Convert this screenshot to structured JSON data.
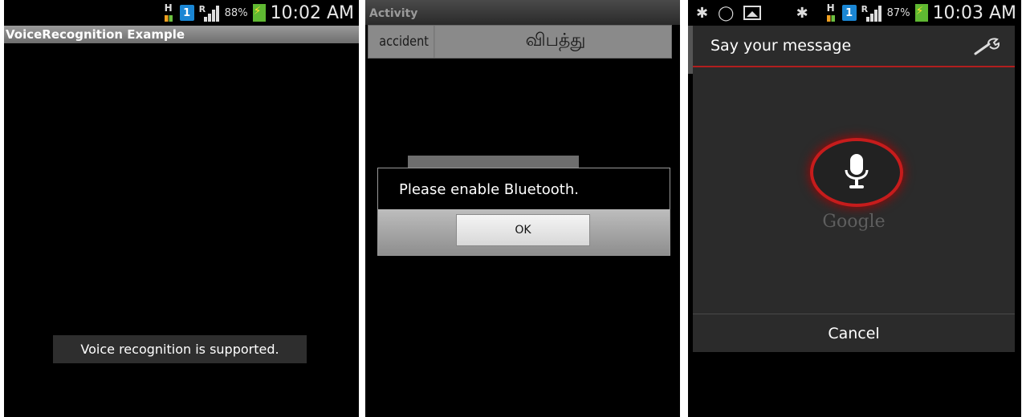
{
  "screen1": {
    "status": {
      "battery": "88%",
      "time": "10:02 AM"
    },
    "title": "VoiceRecognition Example",
    "toast": "Voice recognition is supported."
  },
  "screen2": {
    "title": "Activity",
    "row": {
      "english": "accident",
      "tamil": "விபத்து"
    },
    "dialog": {
      "message": "Please enable Bluetooth.",
      "ok": "OK"
    }
  },
  "screen3": {
    "status": {
      "battery": "87%",
      "time": "10:03 AM"
    },
    "dialog": {
      "title": "Say your message",
      "brand": "Google",
      "cancel": "Cancel"
    }
  },
  "colors": {
    "accent_red": "#c61c1c",
    "battery_green": "#5fb832",
    "sim_blue": "#1a86d4"
  },
  "icons": [
    "h-data-icon",
    "sim-icon",
    "signal-icon",
    "battery-icon",
    "bluetooth-icon",
    "whatsapp-icon",
    "image-icon",
    "wrench-icon",
    "microphone-icon"
  ]
}
